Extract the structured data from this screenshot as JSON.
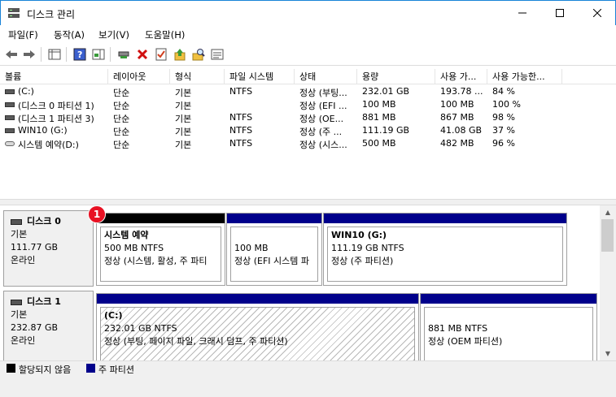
{
  "window": {
    "title": "디스크 관리"
  },
  "menu": [
    "파일(F)",
    "동작(A)",
    "보기(V)",
    "도움말(H)"
  ],
  "toolbar_icons": [
    "back-arrow-icon",
    "forward-arrow-icon",
    "console-tree-icon",
    "help-icon",
    "action-pane-icon",
    "connect-icon",
    "delete-icon",
    "properties-icon",
    "up-folder-icon",
    "search-icon",
    "list-view-icon"
  ],
  "columns": [
    "볼륨",
    "레이아웃",
    "형식",
    "파일 시스템",
    "상태",
    "용량",
    "사용 가...",
    "사용 가능한..."
  ],
  "volumes": [
    {
      "name": "(C:)",
      "layout": "단순",
      "type": "기본",
      "fs": "NTFS",
      "status": "정상 (부팅...",
      "capacity": "232.01 GB",
      "free": "193.78 ...",
      "pct": "84 %"
    },
    {
      "name": "(디스크 0 파티션 1)",
      "layout": "단순",
      "type": "기본",
      "fs": "",
      "status": "정상 (EFI ...",
      "capacity": "100 MB",
      "free": "100 MB",
      "pct": "100 %"
    },
    {
      "name": "(디스크 1 파티션 3)",
      "layout": "단순",
      "type": "기본",
      "fs": "NTFS",
      "status": "정상 (OE...",
      "capacity": "881 MB",
      "free": "867 MB",
      "pct": "98 %"
    },
    {
      "name": "WIN10 (G:)",
      "layout": "단순",
      "type": "기본",
      "fs": "NTFS",
      "status": "정상 (주 ...",
      "capacity": "111.19 GB",
      "free": "41.08 GB",
      "pct": "37 %"
    },
    {
      "name": "시스템 예약(D:)",
      "layout": "단순",
      "type": "기본",
      "fs": "NTFS",
      "status": "정상 (시스...",
      "capacity": "500 MB",
      "free": "482 MB",
      "pct": "96 %"
    }
  ],
  "disks": [
    {
      "name": "디스크 0",
      "kind": "기본",
      "size": "111.77 GB",
      "state": "온라인",
      "partitions": [
        {
          "title": "시스템 예약",
          "line1": "500 MB NTFS",
          "line2": "정상 (시스템, 활성, 주 파티",
          "bar": "#000000"
        },
        {
          "title": "",
          "line1": "100 MB",
          "line2": "정상 (EFI 시스템 파",
          "bar": "#00008b"
        },
        {
          "title": "WIN10  (G:)",
          "line1": "111.19 GB NTFS",
          "line2": "정상 (주 파티션)",
          "bar": "#00008b"
        }
      ]
    },
    {
      "name": "디스크 1",
      "kind": "기본",
      "size": "232.87 GB",
      "state": "온라인",
      "partitions": [
        {
          "title": "(C:)",
          "line1": "232.01 GB NTFS",
          "line2": "정상 (부팅, 페이지 파일, 크래시 덤프, 주 파티션)",
          "bar": "#00008b"
        },
        {
          "title": "",
          "line1": "881 MB NTFS",
          "line2": "정상 (OEM 파티션)",
          "bar": "#00008b"
        }
      ]
    }
  ],
  "legend": [
    {
      "label": "할당되지 않음",
      "color": "#000000"
    },
    {
      "label": "주 파티션",
      "color": "#00008b"
    }
  ],
  "badge": "1"
}
